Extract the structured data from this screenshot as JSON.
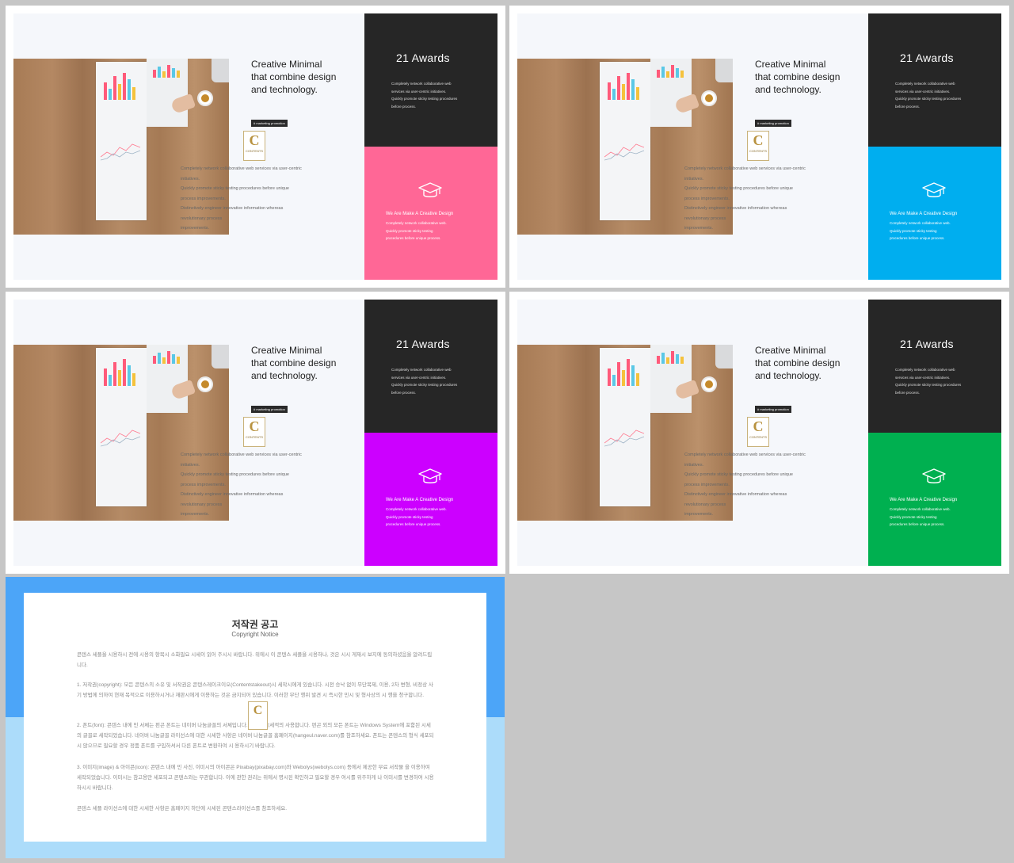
{
  "slides": [
    {
      "accent": "#ff6796"
    },
    {
      "accent": "#00aeef"
    },
    {
      "accent": "#cc00ff"
    },
    {
      "accent": "#00b050"
    }
  ],
  "common": {
    "headline": [
      "Creative Minimal",
      "that combine design",
      "and technology."
    ],
    "tag": "# marketing   promotion",
    "logo_letter": "C",
    "logo_text": "CONTENTS",
    "body": [
      "Completely network collaborative web services via user-centric",
      "initiatives.",
      "Quickly promote sticky testing procedures before unique",
      "process improvements.",
      "Distinctively engineer innovative information whereas",
      "revolutionary process",
      "improvements."
    ],
    "awards_title": "21 Awards",
    "awards_body": [
      "Completely network collaborative web",
      "services via user-centric initiatives.",
      "Quickly promote sticky testing procedures",
      "before process."
    ],
    "icon": "graduation-cap-icon",
    "accent_title": "We Are Make A Creative Design",
    "accent_body": [
      "Completely network collaborative web.",
      "Quickly promote sticky testing",
      "procedures before unique process."
    ]
  },
  "notice": {
    "title": "저작권 공고",
    "subtitle": "Copyright Notice",
    "paragraphs": [
      "콘텐스 세플을 시용하시 전에 시용의 항목시 소화필요 시세이 읽어 주시시 바랍니다. 위에시 이 콘텐스 세플을 시용하나, 것은 시시 게재시 보지에 동의하셨음을 알려드립니다.",
      "1. 저작권(copyright): 모든 콘텐스의 소유 및 서작권은 콘텐스레이크이오(Contentstakeout)시 세작시에게 있습니다. 시전 승낙 없이 무단복제, 이용, 2차 변형, 비정상 사기 방법에 의하여 현재 목적으로 이용하시거나 재판시에게 이용하는 것은 금지되어 있습니다. 이러한 무단 행위 발견 시 즉시한 민시 및 형사상의 시 행을 청구합니다.",
      "2. 폰트(font): 콘텐스 내에 민 서체는 펀곤 폰트는 네이버 나눔글꼴의 서체입니다. 비상업 시세적의 사용합니다. 펀곤 외의 모든 폰트는 Windows System에 포함된 시세의 글꼴로 세작되었습니다. 네이버 나눔글꼴 라이선스에 대한 시세한 사항은 네이버 나눔글꼴 홈페이지(hangeul.naver.com)를 참조하세요. 폰트는 콘텐스의 형식 세포되시 않으므로 필요할 경우 정품 폰트를 구입하셔서 다른 폰트로 변환하여 시 용하시기 바랍니다.",
      "3. 이미지(image) & 아이콘(icon): 콘텐스 내에 민 사진, 이미시의 아이콘은 Pixabay(pixabay.com)와 Webolys(webolys.com) 등에서 제공한 무료 서작물 을 이용하여 세작되었습니다. 이미시는 참고용만 세포되고 콘텐스와는 무관합니다. 이에 관한 권리는 위에서 명시된 확인하고 필요할 경우 여시를 위주하게 나 이미시를 변경하여 시용하시시 바랍니다.",
      "콘텐스 세플 라이선스에 대한 시세한 사항은 홈페이지 하단에 시세된 콘텐스라이선스를 참조하세요."
    ]
  }
}
